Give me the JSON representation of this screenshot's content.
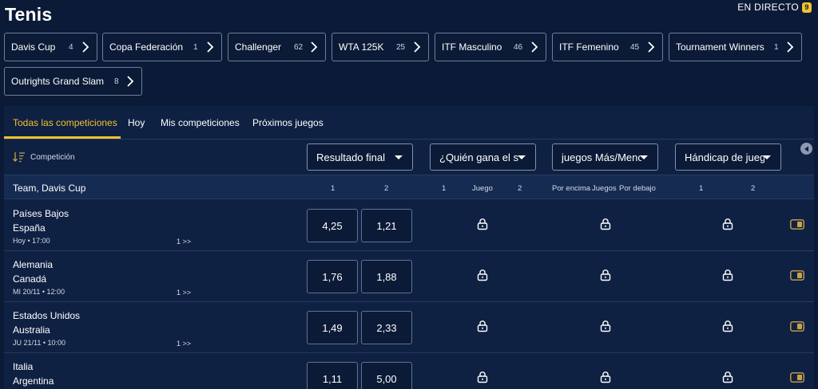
{
  "page": {
    "title": "Tenis"
  },
  "live": {
    "label": "EN DIRECTO",
    "count": "9"
  },
  "competitions": [
    {
      "label": "Davis Cup",
      "count": "4"
    },
    {
      "label": "Copa Federación",
      "count": "1"
    },
    {
      "label": "Challenger",
      "count": "62"
    },
    {
      "label": "WTA 125K",
      "count": "25"
    },
    {
      "label": "ITF Masculino",
      "count": "46"
    },
    {
      "label": "ITF Femenino",
      "count": "45"
    },
    {
      "label": "Tournament Winners",
      "count": "1"
    },
    {
      "label": "Outrights Grand Slam",
      "count": "8"
    }
  ],
  "tabs": [
    {
      "label": "Todas las competiciones",
      "active": true
    },
    {
      "label": "Hoy",
      "active": false
    },
    {
      "label": "Mis competiciones",
      "active": false
    },
    {
      "label": "Próximos juegos",
      "active": false
    }
  ],
  "filters": {
    "sort_label": "Competición",
    "markets": [
      "Resultado final",
      "¿Quién gana el s",
      "juegos Más/Meno",
      "Hándicap de jueg"
    ]
  },
  "group": {
    "title": "Team, Davis Cup",
    "columns": {
      "m1_a": "1",
      "m1_b": "2",
      "m2_a": "1",
      "m2_mid": "Juego",
      "m2_b": "2",
      "m3_a": "Por encima",
      "m3_mid": "Juegos",
      "m3_b": "Por debajo",
      "m4_a": "1",
      "m4_b": "2"
    }
  },
  "matches": [
    {
      "home": "Países Bajos",
      "away": "España",
      "time": "Hoy • 17:00",
      "more": "1 >>",
      "odd1": "4,25",
      "odd2": "1,21"
    },
    {
      "home": "Alemania",
      "away": "Canadá",
      "time": "MI 20/11 • 12:00",
      "more": "1 >>",
      "odd1": "1,76",
      "odd2": "1,88"
    },
    {
      "home": "Estados Unidos",
      "away": "Australia",
      "time": "JU 21/11 • 10:00",
      "more": "1 >>",
      "odd1": "1,49",
      "odd2": "2,33"
    },
    {
      "home": "Italia",
      "away": "Argentina",
      "time": "",
      "more": "",
      "odd1": "1,11",
      "odd2": "5,00"
    }
  ],
  "icons": {
    "chevron": "chevron-right-icon",
    "sort": "sort-icon",
    "lock": "lock-icon",
    "toggle": "toggle-icon",
    "scroll": "scroll-left-icon"
  },
  "colors": {
    "background": "#0b1a36",
    "panel": "#0f2143",
    "accent": "#f2c12e",
    "border": "#6d7f9e"
  }
}
